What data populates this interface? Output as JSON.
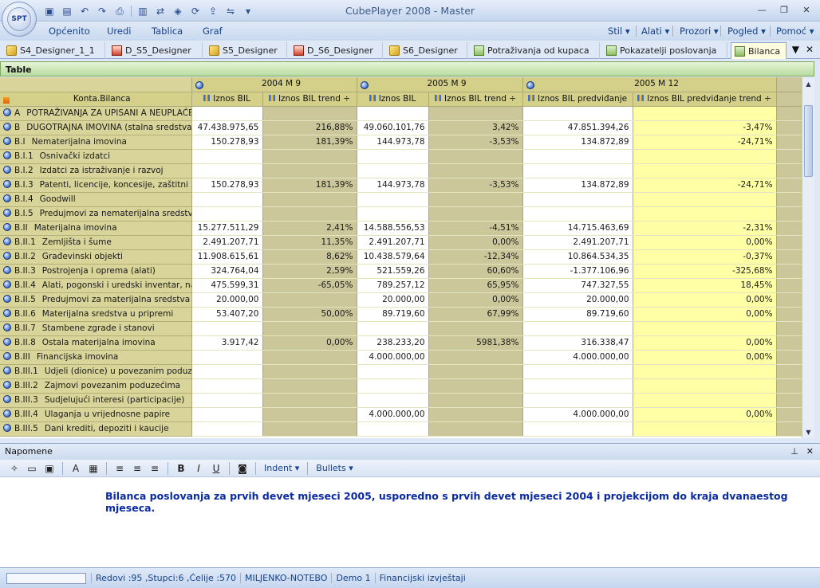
{
  "window": {
    "title": "CubePlayer 2008 - Master",
    "logo_text": "SPT"
  },
  "menu": {
    "left": [
      "Općenito",
      "Uredi",
      "Tablica",
      "Graf"
    ],
    "right": [
      "Stil ▾",
      "Alati ▾",
      "Prozori ▾",
      "Pogled ▾",
      "Pomoć ▾"
    ]
  },
  "tabs": [
    {
      "label": "S4_Designer_1_1",
      "icon": "cube-icon"
    },
    {
      "label": "D_S5_Designer",
      "icon": "designer-icon"
    },
    {
      "label": "S5_Designer",
      "icon": "cube-icon"
    },
    {
      "label": "D_S6_Designer",
      "icon": "designer-icon"
    },
    {
      "label": "S6_Designer",
      "icon": "cube-icon"
    },
    {
      "label": "Potraživanja od kupaca",
      "icon": "grid-icon"
    },
    {
      "label": "Pokazatelji poslovanja",
      "icon": "grid-icon"
    },
    {
      "label": "Bilanca",
      "icon": "grid-icon",
      "active": true
    }
  ],
  "table": {
    "title": "Table",
    "row_header_label": "Konta.Bilanca",
    "periods": [
      "2004 M 9",
      "2005 M 9",
      "2005 M 12"
    ],
    "columns": [
      "Iznos BIL",
      "Iznos BIL trend ÷",
      "Iznos BIL",
      "Iznos BIL trend ÷",
      "Iznos BIL predviđanje",
      "Iznos BIL predviđanje trend ÷"
    ],
    "rows": [
      {
        "code": "A",
        "name": "POTRAŽIVANJA ZA UPISANI A NEUPLAĆE",
        "v": [
          "",
          "",
          "",
          "",
          "",
          ""
        ]
      },
      {
        "code": "B",
        "name": "DUGOTRAJNA IMOVINA (stalna sredstva)",
        "v": [
          "47.438.975,65",
          "216,88%",
          "49.060.101,76",
          "3,42%",
          "47.851.394,26",
          "-3,47%"
        ]
      },
      {
        "code": "B.I",
        "name": "Nematerijalna imovina",
        "v": [
          "150.278,93",
          "181,39%",
          "144.973,78",
          "-3,53%",
          "134.872,89",
          "-24,71%"
        ]
      },
      {
        "code": "B.I.1",
        "name": "Osnivački izdatci",
        "v": [
          "",
          "",
          "",
          "",
          "",
          ""
        ]
      },
      {
        "code": "B.I.2",
        "name": "Izdatci za istraživanje i razvoj",
        "v": [
          "",
          "",
          "",
          "",
          "",
          ""
        ]
      },
      {
        "code": "B.I.3",
        "name": "Patenti, licencije, koncesije, zaštitni zı",
        "v": [
          "150.278,93",
          "181,39%",
          "144.973,78",
          "-3,53%",
          "134.872,89",
          "-24,71%"
        ]
      },
      {
        "code": "B.I.4",
        "name": "Goodwill",
        "v": [
          "",
          "",
          "",
          "",
          "",
          ""
        ]
      },
      {
        "code": "B.I.5",
        "name": "Predujmovi za nematerijalna sredstva",
        "v": [
          "",
          "",
          "",
          "",
          "",
          ""
        ]
      },
      {
        "code": "B.II",
        "name": "Materijalna imovina",
        "v": [
          "15.277.511,29",
          "2,41%",
          "14.588.556,53",
          "-4,51%",
          "14.715.463,69",
          "-2,31%"
        ]
      },
      {
        "code": "B.II.1",
        "name": "Zemljišta i šume",
        "v": [
          "2.491.207,71",
          "11,35%",
          "2.491.207,71",
          "0,00%",
          "2.491.207,71",
          "0,00%"
        ]
      },
      {
        "code": "B.II.2",
        "name": "Građevinski objekti",
        "v": [
          "11.908.615,61",
          "8,62%",
          "10.438.579,64",
          "-12,34%",
          "10.864.534,35",
          "-0,37%"
        ]
      },
      {
        "code": "B.II.3",
        "name": "Postrojenja i oprema (alati)",
        "v": [
          "324.764,04",
          "2,59%",
          "521.559,26",
          "60,60%",
          "-1.377.106,96",
          "-325,68%"
        ]
      },
      {
        "code": "B.II.4",
        "name": "Alati, pogonski i uredski inventar, na",
        "v": [
          "475.599,31",
          "-65,05%",
          "789.257,12",
          "65,95%",
          "747.327,55",
          "18,45%"
        ]
      },
      {
        "code": "B.II.5",
        "name": "Predujmovi za materijalna sredstva",
        "v": [
          "20.000,00",
          "",
          "20.000,00",
          "0,00%",
          "20.000,00",
          "0,00%"
        ]
      },
      {
        "code": "B.II.6",
        "name": "Materijalna sredstva u pripremi",
        "v": [
          "53.407,20",
          "50,00%",
          "89.719,60",
          "67,99%",
          "89.719,60",
          "0,00%"
        ]
      },
      {
        "code": "B.II.7",
        "name": "Stambene zgrade i stanovi",
        "v": [
          "",
          "",
          "",
          "",
          "",
          ""
        ]
      },
      {
        "code": "B.II.8",
        "name": "Ostala materijalna imovina",
        "v": [
          "3.917,42",
          "0,00%",
          "238.233,20",
          "5981,38%",
          "316.338,47",
          "0,00%"
        ]
      },
      {
        "code": "B.III",
        "name": "Financijska imovina",
        "v": [
          "",
          "",
          "4.000.000,00",
          "",
          "4.000.000,00",
          "0,00%"
        ]
      },
      {
        "code": "B.III.1",
        "name": "Udjeli (dionice) u povezanim poduze",
        "v": [
          "",
          "",
          "",
          "",
          "",
          ""
        ]
      },
      {
        "code": "B.III.2",
        "name": "Zajmovi povezanim poduzećima",
        "v": [
          "",
          "",
          "",
          "",
          "",
          ""
        ]
      },
      {
        "code": "B.III.3",
        "name": "Sudjelujući interesi (participacije)",
        "v": [
          "",
          "",
          "",
          "",
          "",
          ""
        ]
      },
      {
        "code": "B.III.4",
        "name": "Ulaganja u vrijednosne papire",
        "v": [
          "",
          "",
          "4.000.000,00",
          "",
          "4.000.000,00",
          "0,00%"
        ]
      },
      {
        "code": "B.III.5",
        "name": "Dani krediti, depoziti i kaucije",
        "v": [
          "",
          "",
          "",
          "",
          "",
          ""
        ]
      }
    ]
  },
  "notes": {
    "title": "Napomene",
    "toolbar_dropdowns": [
      "Indent ▾",
      "Bullets ▾"
    ],
    "text": "Bilanca poslovanja za prvih devet mjeseci 2005, usporedno s prvih devet mjeseci 2004 i projekcijom do kraja dvanaestog mjeseca."
  },
  "status": {
    "counts": "Redovi :95 ,Stupci:6 ,Ćelije :570",
    "machine": "MILJENKO-NOTEBO",
    "db": "Demo 1",
    "category": "Financijski izvještaji"
  }
}
